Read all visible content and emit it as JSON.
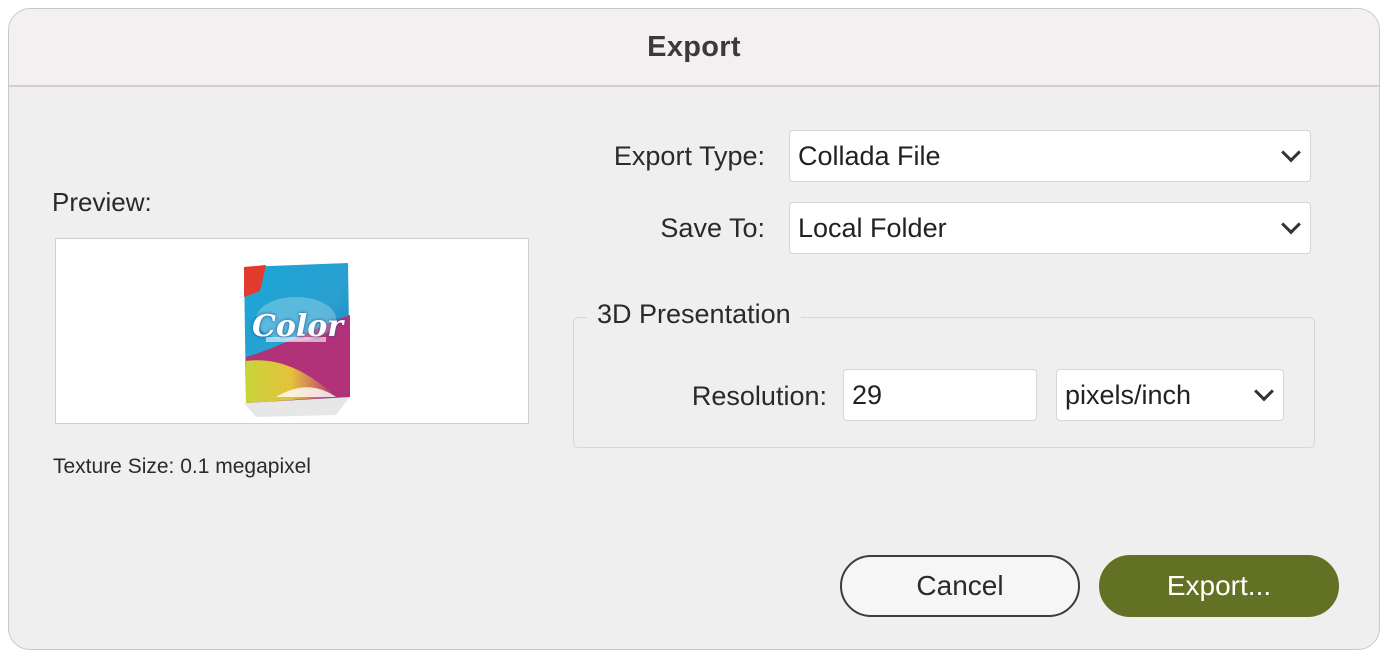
{
  "dialog": {
    "title": "Export"
  },
  "preview": {
    "label": "Preview:",
    "image_icon": "product-package-image",
    "package_text": "Color",
    "texture_size": "Texture Size: 0.1 megapixel"
  },
  "export_type": {
    "label": "Export Type:",
    "value": "Collada File",
    "icon": "chevron-down-icon"
  },
  "save_to": {
    "label": "Save To:",
    "value": "Local Folder",
    "icon": "chevron-down-icon"
  },
  "presentation": {
    "legend": "3D Presentation",
    "resolution_label": "Resolution:",
    "resolution_value": "29",
    "unit_value": "pixels/inch"
  },
  "buttons": {
    "cancel": "Cancel",
    "export": "Export..."
  },
  "colors": {
    "accent": "#637124",
    "background": "#efefef",
    "titlebar": "#f4eff1"
  }
}
